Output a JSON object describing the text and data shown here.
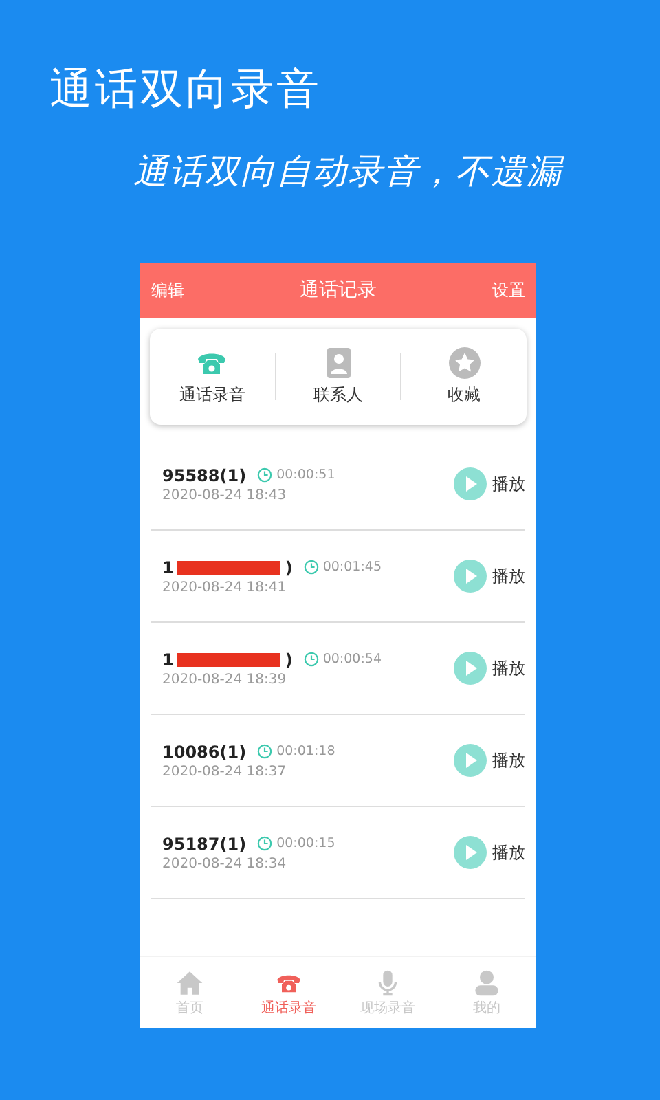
{
  "headline": "通话双向录音",
  "subtitle": "通话双向自动录音，不遗漏",
  "header": {
    "left": "编辑",
    "title": "通话记录",
    "right": "设置"
  },
  "categories": [
    {
      "kind": "phone",
      "label": "通话录音",
      "selected": true
    },
    {
      "kind": "contacts",
      "label": "联系人",
      "selected": false
    },
    {
      "kind": "star",
      "label": "收藏",
      "selected": false
    }
  ],
  "records": [
    {
      "number": "95588(1)",
      "redacted": false,
      "duration": "00:00:51",
      "time": "2020-08-24 18:43",
      "action": "播放"
    },
    {
      "number": "1",
      "number_end": ")",
      "redacted": true,
      "duration": "00:01:45",
      "time": "2020-08-24 18:41",
      "action": "播放"
    },
    {
      "number": "1",
      "number_end": ")",
      "redacted": true,
      "duration": "00:00:54",
      "time": "2020-08-24 18:39",
      "action": "播放"
    },
    {
      "number": "10086(1)",
      "redacted": false,
      "duration": "00:01:18",
      "time": "2020-08-24 18:37",
      "action": "播放"
    },
    {
      "number": "95187(1)",
      "redacted": false,
      "duration": "00:00:15",
      "time": "2020-08-24 18:34",
      "action": "播放"
    }
  ],
  "nav": [
    {
      "kind": "home",
      "label": "首页",
      "selected": false
    },
    {
      "kind": "phone",
      "label": "通话录音",
      "selected": true
    },
    {
      "kind": "mic",
      "label": "现场录音",
      "selected": false
    },
    {
      "kind": "person",
      "label": "我的",
      "selected": false
    }
  ]
}
